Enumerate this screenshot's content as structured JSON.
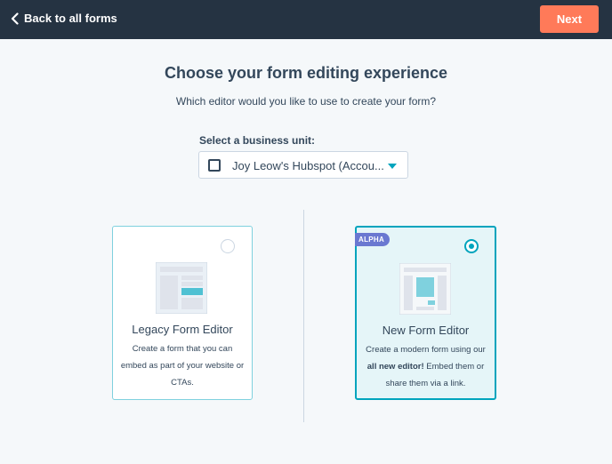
{
  "header": {
    "back_label": "Back to all forms",
    "next_label": "Next"
  },
  "main": {
    "title": "Choose your form editing experience",
    "subtitle": "Which editor would you like to use to create your form?"
  },
  "business_unit": {
    "label": "Select a business unit:",
    "value": "Joy Leow's Hubspot (Accou..."
  },
  "options": [
    {
      "title": "Legacy Form Editor",
      "description": "Create a form that you can embed as part of your website or CTAs.",
      "selected": false
    },
    {
      "badge": "ALPHA",
      "title": "New Form Editor",
      "description_pre": "Create a modern form using our ",
      "description_bold": "all new editor!",
      "description_post": " Embed them or share them via a link.",
      "selected": true
    }
  ],
  "colors": {
    "topbar": "#253342",
    "next_button": "#ff7a59",
    "accent": "#00a4bd",
    "badge": "#6a78d1",
    "background": "#f5f8fa"
  }
}
